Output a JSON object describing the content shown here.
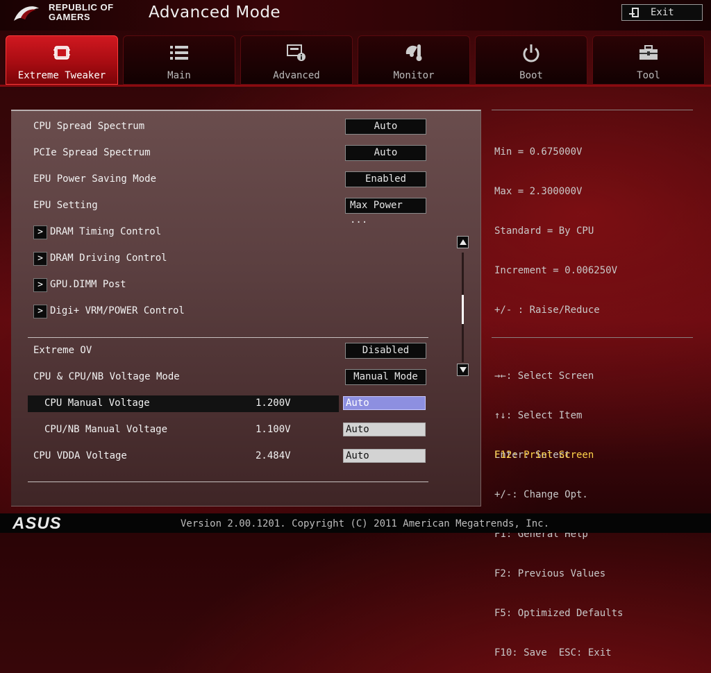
{
  "header": {
    "brand_line1": "REPUBLIC OF",
    "brand_line2": "GAMERS",
    "title": "Advanced Mode",
    "exit_label": "Exit"
  },
  "tabs": [
    {
      "label": "Extreme Tweaker",
      "icon": "tweaker-icon",
      "active": true
    },
    {
      "label": "Main",
      "icon": "list-icon",
      "active": false
    },
    {
      "label": "Advanced",
      "icon": "advanced-info-icon",
      "active": false
    },
    {
      "label": "Monitor",
      "icon": "thermometer-fan-icon",
      "active": false
    },
    {
      "label": "Boot",
      "icon": "power-icon",
      "active": false
    },
    {
      "label": "Tool",
      "icon": "toolbox-icon",
      "active": false
    }
  ],
  "settings": {
    "cpu_spread": {
      "label": "CPU Spread Spectrum",
      "value": "Auto"
    },
    "pcie_spread": {
      "label": "PCIe Spread Spectrum",
      "value": "Auto"
    },
    "epu_mode": {
      "label": "EPU Power Saving Mode",
      "value": "Enabled"
    },
    "epu_setting": {
      "label": "EPU Setting",
      "value": "Max Power ..."
    },
    "submenus": [
      {
        "label": "DRAM Timing Control"
      },
      {
        "label": "DRAM Driving Control"
      },
      {
        "label": "GPU.DIMM Post"
      },
      {
        "label": "Digi+ VRM/POWER Control"
      }
    ],
    "extreme_ov": {
      "label": "Extreme OV",
      "value": "Disabled"
    },
    "voltage_mode": {
      "label": "CPU & CPU/NB Voltage Mode",
      "value": "Manual Mode"
    },
    "cpu_manual": {
      "label": "CPU Manual Voltage",
      "current": "1.200V",
      "value": "Auto"
    },
    "cpunb_manual": {
      "label": "CPU/NB Manual Voltage",
      "current": "1.100V",
      "value": "Auto"
    },
    "cpu_vdda": {
      "label": "CPU VDDA Voltage",
      "current": "2.484V",
      "value": "Auto"
    },
    "submenu_arrow": ">"
  },
  "help_top": [
    "Min = 0.675000V",
    "Max = 2.300000V",
    "Standard = By CPU",
    "Increment = 0.006250V",
    "+/- : Raise/Reduce"
  ],
  "help_keys": [
    "→←: Select Screen",
    "↑↓: Select Item",
    "Enter: Select",
    "+/-: Change Opt.",
    "F1: General Help",
    "F2: Previous Values",
    "F5: Optimized Defaults",
    "F10: Save  ESC: Exit"
  ],
  "help_highlight": "F12: Print Screen",
  "footer": {
    "logo": "ASUS",
    "version": "Version 2.00.1201. Copyright (C) 2011 American Megatrends, Inc."
  },
  "colors": {
    "accent_red": "#c8141c",
    "selected_field": "#8d8fe0",
    "highlight_text": "#ffd24a"
  }
}
